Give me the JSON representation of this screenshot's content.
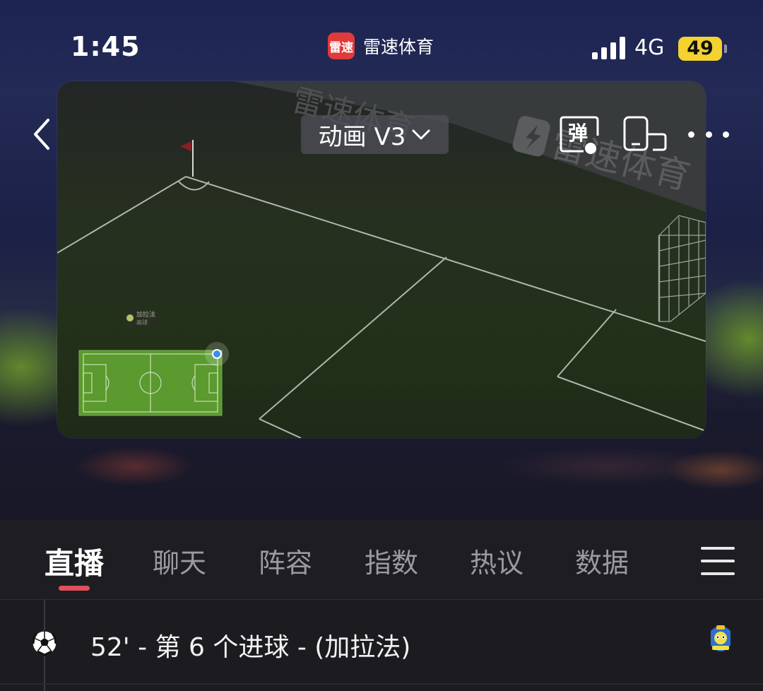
{
  "status_bar": {
    "time": "1:45",
    "app_logo_text": "雷速",
    "app_name": "雷速体育",
    "network": "4G",
    "battery": "49"
  },
  "player": {
    "mode_label": "动画 V3",
    "danmu_label": "弹",
    "banner_text": "雷速体育",
    "team_label": "加拉法",
    "team_sub_label": "高球"
  },
  "tabs": {
    "items": [
      {
        "label": "直播",
        "active": true
      },
      {
        "label": "聊天",
        "active": false
      },
      {
        "label": "阵容",
        "active": false
      },
      {
        "label": "指数",
        "active": false
      },
      {
        "label": "热议",
        "active": false
      },
      {
        "label": "数据",
        "active": false
      }
    ]
  },
  "events": [
    {
      "text": "52' - 第 6 个进球 - (加拉法)",
      "icon": "soccer-ball-icon",
      "team_icon": "team-logo-icon"
    }
  ],
  "colors": {
    "accent": "#e0505a",
    "battery": "#f4d230",
    "pitch": "#5a9a2e"
  }
}
